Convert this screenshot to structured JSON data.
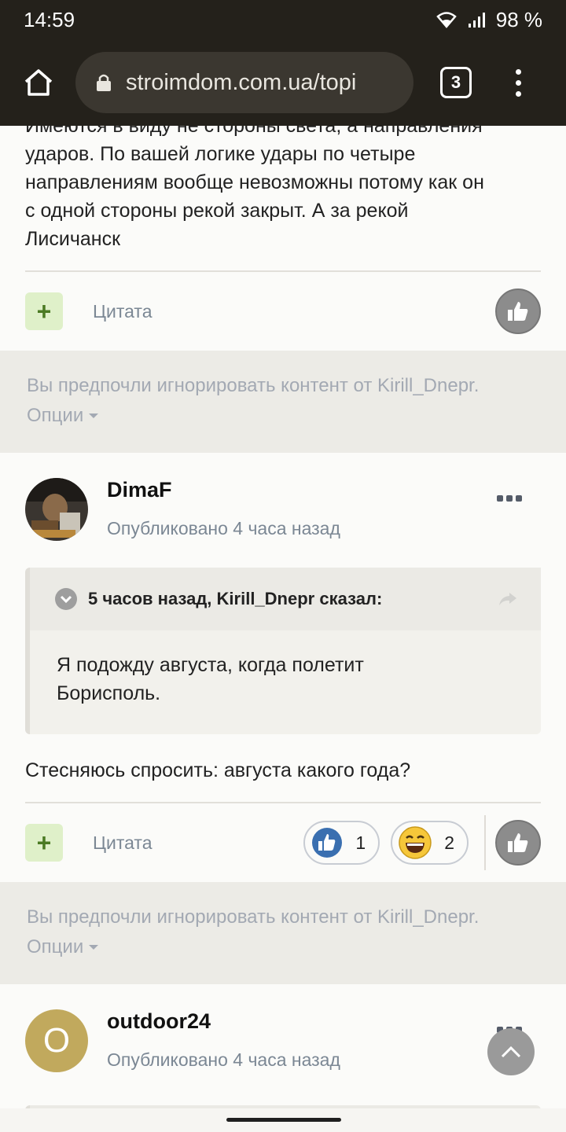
{
  "status_bar": {
    "time": "14:59",
    "battery": "98 %"
  },
  "browser": {
    "url": "stroimdom.com.ua/topi",
    "tab_count": "3"
  },
  "post1": {
    "cut_line": "Имеются в виду не стороны света, а направления",
    "lines": [
      "ударов. По вашей логике удары по четыре",
      "направлениям вообще невозможны потому как он",
      "с одной стороны рекой закрыт. А за рекой",
      "Лисичанск"
    ],
    "plus_label": "+",
    "quote_label": "Цитата"
  },
  "ignored1": {
    "text": "Вы предпочли игнорировать контент от Kirill_Dnepr.",
    "options_label": "Опции"
  },
  "post2": {
    "author": "DimaF",
    "date": "Опубликовано 4 часа назад",
    "quote_header": "5 часов назад, Kirill_Dnepr сказал:",
    "quote_lines": [
      "Я подожду августа, когда полетит",
      "Борисполь."
    ],
    "reply": "Стесняюсь спросить: августа какого года?",
    "plus_label": "+",
    "quote_label": "Цитата",
    "reactions": [
      {
        "icon": "thumbs-up-reaction-icon",
        "count": "1"
      },
      {
        "icon": "laughing-face-reaction-icon",
        "count": "2"
      }
    ]
  },
  "ignored2": {
    "text": "Вы предпочли игнорировать контент от Kirill_Dnepr.",
    "options_label": "Опции"
  },
  "post3": {
    "author": "outdoor24",
    "avatar_letter": "O",
    "date": "Опубликовано 4 часа назад"
  },
  "colors": {
    "chrome": "#24211b",
    "accent_green": "#dff0c9",
    "muted_text": "#7b8794"
  }
}
